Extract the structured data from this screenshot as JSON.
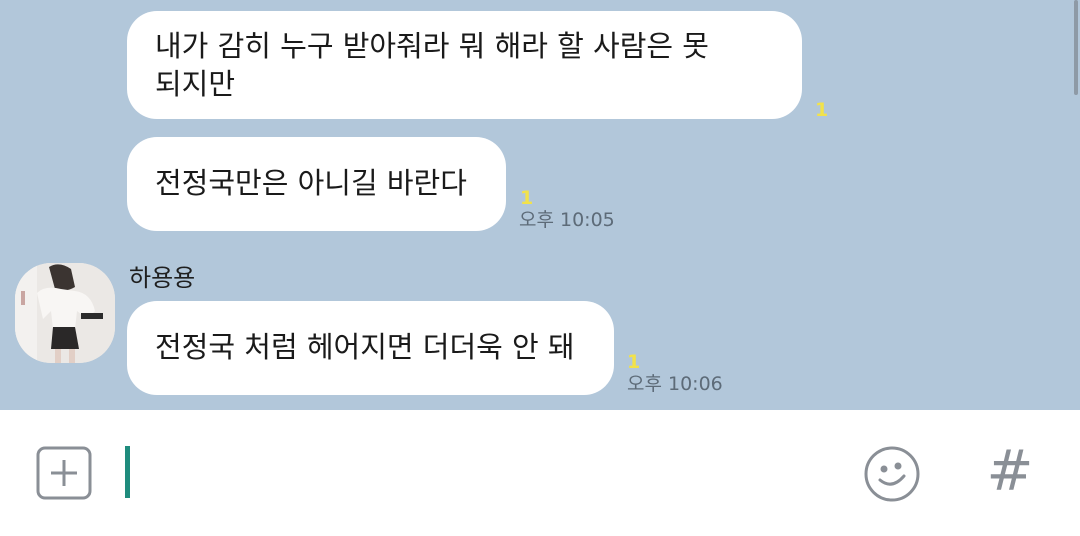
{
  "messages": [
    {
      "text": "내가 감히 누구 받아줘라 뭐 해라 할 사람은 못\n되지만",
      "unread": "1",
      "time": ""
    },
    {
      "text": "전정국만은 아니길 바란다",
      "unread": "1",
      "time": "오후 10:05"
    },
    {
      "sender": "하용용",
      "text": "전정국 처럼 헤어지면 더더욱 안 돼",
      "unread": "1",
      "time": "오후 10:06"
    }
  ],
  "input": {
    "value": "",
    "hash_symbol": "#"
  },
  "icons": {
    "add": "plus-square-icon",
    "emoji": "smiley-icon",
    "hashtag": "hash-icon",
    "avatar": "profile-photo"
  },
  "colors": {
    "chat_background": "#b2c7da",
    "bubble": "#ffffff",
    "unread": "#f2e24a",
    "cursor": "#1f8c7d"
  }
}
